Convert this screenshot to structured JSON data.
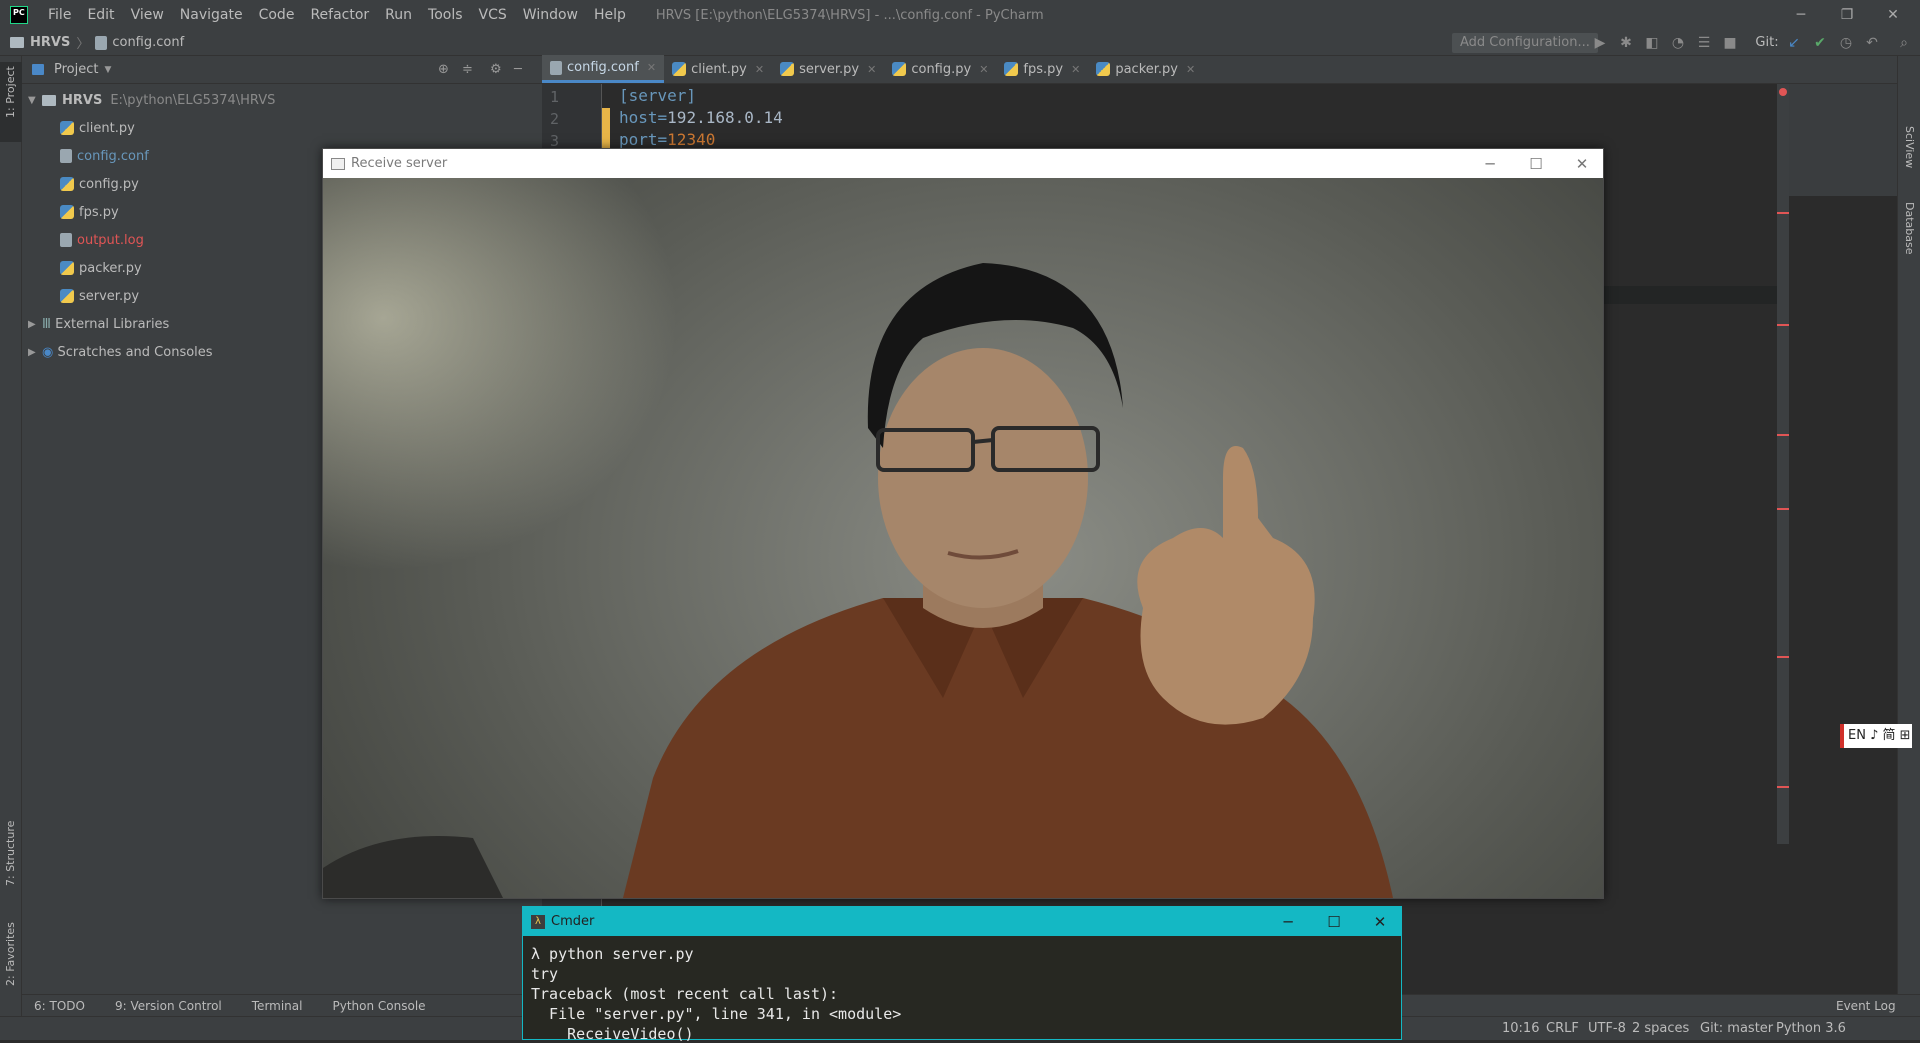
{
  "titlebar": {
    "menu": [
      "File",
      "Edit",
      "View",
      "Navigate",
      "Code",
      "Refactor",
      "Run",
      "Tools",
      "VCS",
      "Window",
      "Help"
    ],
    "title": "HRVS [E:\\python\\ELG5374\\HRVS] - ...\\config.conf - PyCharm"
  },
  "navbar": {
    "project": "HRVS",
    "file": "config.conf",
    "add_config": "Add Configuration...",
    "git_label": "Git:"
  },
  "sidebar": {
    "project_tab": "1: Project",
    "structure_tab": "7: Structure",
    "favorites_tab": "2: Favorites"
  },
  "project_panel": {
    "title": "Project",
    "root_name": "HRVS",
    "root_path": "E:\\python\\ELG5374\\HRVS",
    "files": [
      "client.py",
      "config.conf",
      "config.py",
      "fps.py",
      "output.log",
      "packer.py",
      "server.py"
    ],
    "external": "External Libraries",
    "scratches": "Scratches and Consoles"
  },
  "tabs": [
    "config.conf",
    "client.py",
    "server.py",
    "config.py",
    "fps.py",
    "packer.py"
  ],
  "editor": {
    "line_numbers": [
      "1",
      "2",
      "3"
    ],
    "line1": "[server]",
    "line2_key": "host=",
    "line2_val": "192.168.0.14",
    "line3_key": "port=",
    "line3_val": "12340"
  },
  "right_stripe": {
    "sciview": "SciView",
    "database": "Database"
  },
  "receive_window": {
    "title": "Receive server"
  },
  "cmder": {
    "title": "Cmder",
    "lines": [
      "λ python server.py",
      "try",
      "Traceback (most recent call last):",
      "  File \"server.py\", line 341, in <module>",
      "    ReceiveVideo()"
    ]
  },
  "bottom_tools": [
    "6: TODO",
    "9: Version Control",
    "Terminal",
    "Python Console"
  ],
  "event_log": "Event Log",
  "status": {
    "position": "10:16",
    "line_sep": "CRLF",
    "encoding": "UTF-8",
    "indent": "2 spaces",
    "git": "Git: master",
    "python": "Python 3.6"
  },
  "ime": "EN ♪ 简 ⊞",
  "colors": {
    "accent": "#4a88c7",
    "cmder": "#14b8c4",
    "keyword": "#cc7832",
    "bracket": "#6897bb",
    "string": "#a9b7c6",
    "error": "#e05555"
  }
}
